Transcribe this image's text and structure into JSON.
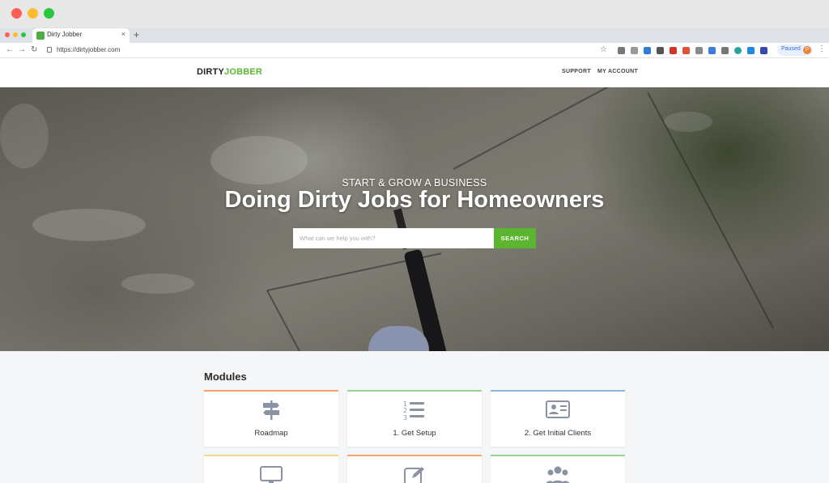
{
  "browser": {
    "tab_title": "Dirty Jobber",
    "tab_close": "×",
    "new_tab": "+",
    "url": "https://dirtyjobber.com",
    "profile_status": "Paused",
    "profile_initial": "P",
    "icons": [
      "back-arrow-icon",
      "forward-arrow-icon",
      "reload-icon",
      "lock-icon",
      "star-icon",
      "menu-icon"
    ]
  },
  "site": {
    "logo_part1": "DIRTY",
    "logo_part2": "JOBBER",
    "brand_color": "#5cb531",
    "nav": [
      {
        "label": "SUPPORT"
      },
      {
        "label": "MY ACCOUNT"
      }
    ]
  },
  "hero": {
    "kicker": "START & GROW A BUSINESS",
    "title": "Doing Dirty Jobs for Homeowners",
    "search_placeholder": "What can we help you with?",
    "search_value": "",
    "search_button": "SEARCH"
  },
  "modules": {
    "heading": "Modules",
    "items": [
      {
        "label": "Roadmap",
        "icon": "signpost-icon",
        "accent": "#f0a36b"
      },
      {
        "label": "1. Get Setup",
        "icon": "numbered-list-icon",
        "accent": "#9bd48f"
      },
      {
        "label": "2. Get Initial Clients",
        "icon": "contact-card-icon",
        "accent": "#8fb5e3"
      },
      {
        "label": "",
        "icon": "monitor-icon",
        "accent": "#f3d98a"
      },
      {
        "label": "",
        "icon": "edit-icon",
        "accent": "#f0a36b"
      },
      {
        "label": "",
        "icon": "group-icon",
        "accent": "#9bd48f"
      }
    ]
  }
}
